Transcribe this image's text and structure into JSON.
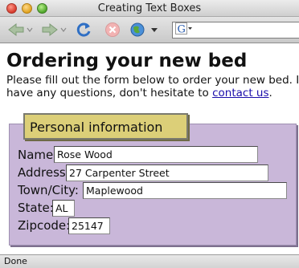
{
  "window": {
    "title": "Creating Text Boxes"
  },
  "toolbar": {
    "back_icon": "back-arrow-icon",
    "forward_icon": "forward-arrow-icon",
    "reload_icon": "reload-icon",
    "stop_icon": "stop-icon",
    "home_icon": "globe-icon",
    "search_engine_icon": "google-icon"
  },
  "page": {
    "heading": "Ordering your new bed",
    "intro_line1": "Please fill out the form below to order your new bed. If y",
    "intro_line2_before": "have any questions, don't hesitate to ",
    "intro_link": "contact us",
    "intro_line2_after": "."
  },
  "form": {
    "legend": "Personal information",
    "fields": [
      {
        "label": "Name:",
        "value": "Rose Wood"
      },
      {
        "label": "Address:",
        "value": "27 Carpenter Street"
      },
      {
        "label": "Town/City:",
        "value": "Maplewood"
      },
      {
        "label": "State:",
        "value": "AL"
      },
      {
        "label": "Zipcode:",
        "value": "25147"
      }
    ]
  },
  "status": {
    "text": "Done"
  },
  "colors": {
    "fieldset_bg": "#c9b7d9",
    "legend_bg": "#dccf78",
    "link": "#1a0dab"
  }
}
